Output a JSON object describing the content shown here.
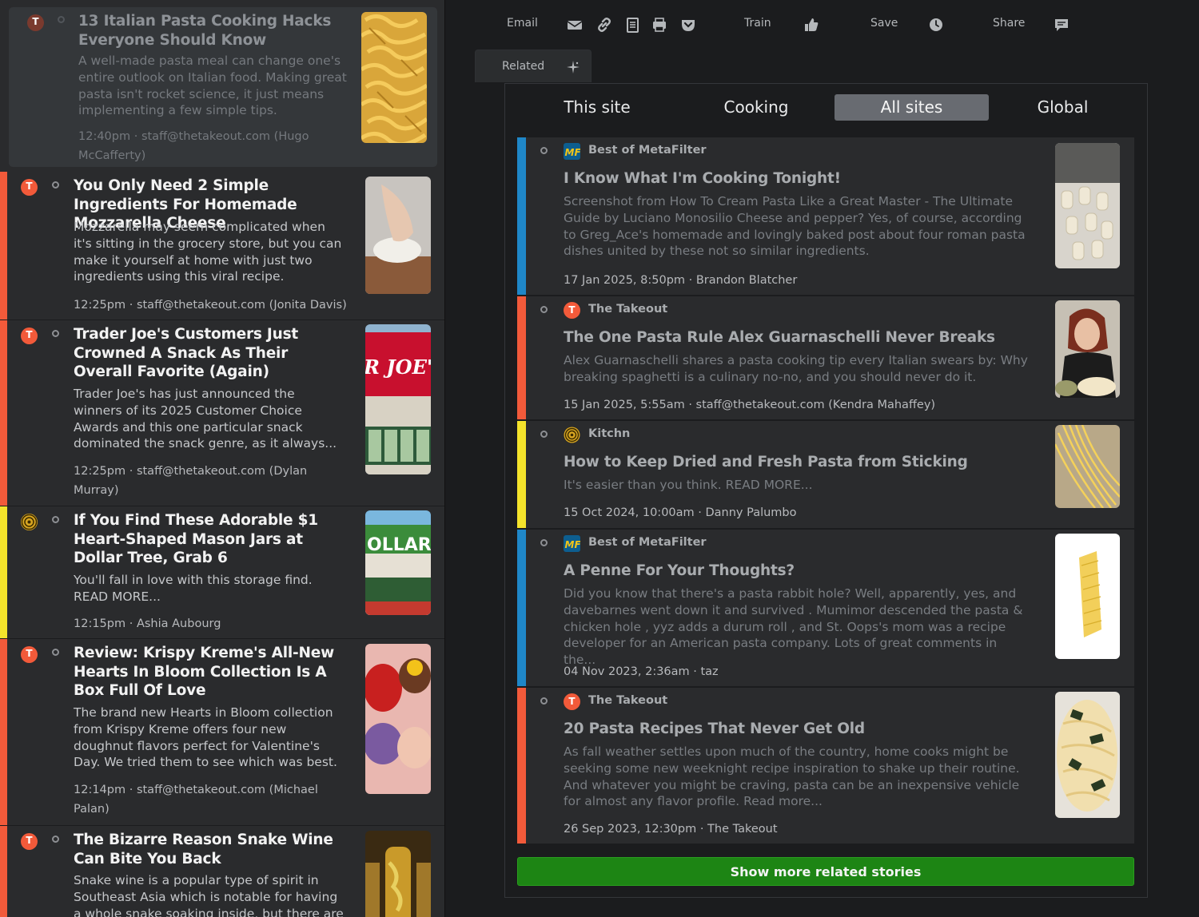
{
  "colors": {
    "takeout": "#f25a3a",
    "kitchn": "#f4e32b",
    "metafilter": "#1f87c8",
    "show_more": "#1d8514"
  },
  "toolbar": {
    "email": "Email",
    "train": "Train",
    "save": "Save",
    "share": "Share",
    "related": "Related",
    "icons": [
      "envelope-icon",
      "link-icon",
      "document-icon",
      "printer-icon",
      "pocket-icon",
      "thumbs-up-icon",
      "clock-icon",
      "comment-icon",
      "sparkle-icon"
    ]
  },
  "feed": {
    "stories": [
      {
        "title": "13 Italian Pasta Cooking Hacks Everyone Should Know",
        "snippet": "A well-made pasta meal can change one's entire outlook on Italian food. Making great pasta isn't rocket science, it just means implementing a few simple tips.",
        "meta": "12:40pm · staff@thetakeout.com (Hugo McCafferty)",
        "favicon": "T",
        "selected": true
      },
      {
        "title": "You Only Need 2 Simple Ingredients For Homemade Mozzarella Cheese",
        "snippet": "Mozzarella may seem complicated when it's sitting in the grocery store, but you can make it yourself at home with just two ingredients using this viral recipe.",
        "meta": "12:25pm · staff@thetakeout.com (Jonita Davis)",
        "favicon": "T"
      },
      {
        "title": "Trader Joe's Customers Just Crowned A Snack As Their Overall Favorite (Again)",
        "snippet": "Trader Joe's has just announced the winners of its 2025 Customer Choice Awards and this one particular snack dominated the snack genre, as it always...",
        "meta": "12:25pm · staff@thetakeout.com (Dylan Murray)",
        "favicon": "T",
        "thumb_text": "R JOE'"
      },
      {
        "title": "If You Find These Adorable $1 Heart-Shaped Mason Jars at Dollar Tree, Grab 6",
        "snippet": "You'll fall in love with this storage find. READ MORE...",
        "meta": "12:15pm · Ashia Aubourg",
        "favicon": "kitchn",
        "thumb_text": "OLLAR"
      },
      {
        "title": "Review: Krispy Kreme's All-New Hearts In Bloom Collection Is A Box Full Of Love",
        "snippet": "The brand new Hearts in Bloom collection from Krispy Kreme offers four new doughnut flavors perfect for Valentine's Day. We tried them to see which was best.",
        "meta": "12:14pm · staff@thetakeout.com (Michael Palan)",
        "favicon": "T"
      },
      {
        "title": "The Bizarre Reason Snake Wine Can Bite You Back",
        "snippet": "Snake wine is a popular type of spirit in Southeast Asia which is notable for having a whole snake soaking inside, but there are",
        "meta": "",
        "favicon": "T"
      }
    ]
  },
  "related": {
    "tabs": [
      "This site",
      "Cooking",
      "All sites",
      "Global"
    ],
    "active_tab": "All sites",
    "stories": [
      {
        "feed": "Best of MetaFilter",
        "feed_icon": "MF",
        "title": "I Know What I'm Cooking Tonight!",
        "snippet": "Screenshot from How To Cream Pasta Like a Great Master - The Ultimate Guide by Luciano Monosilio Cheese and pepper? Yes, of course, according to Greg_Ace's homemade and lovingly baked post about four roman pasta dishes united by these not so similar ingredients.",
        "meta": "17 Jan 2025, 8:50pm · Brandon Blatcher"
      },
      {
        "feed": "The Takeout",
        "feed_icon": "T",
        "title": "The One Pasta Rule Alex Guarnaschelli Never Breaks",
        "snippet": "Alex Guarnaschelli shares a pasta cooking tip every Italian swears by: Why breaking spaghetti is a culinary no-no, and you should never do it.",
        "meta": "15 Jan 2025, 5:55am · staff@thetakeout.com (Kendra Mahaffey)"
      },
      {
        "feed": "Kitchn",
        "feed_icon": "kitchn",
        "title": "How to Keep Dried and Fresh Pasta from Sticking",
        "snippet": "It's easier than you think. READ MORE...",
        "meta": "15 Oct 2024, 10:00am · Danny Palumbo"
      },
      {
        "feed": "Best of MetaFilter",
        "feed_icon": "MF",
        "title": "A Penne For Your Thoughts?",
        "snippet": "Did you know that there's a pasta rabbit hole? Well, apparently, yes, and davebarnes went down it and survived . Mumimor descended the pasta & chicken hole , yyz adds a durum roll , and St. Oops's mom was a recipe developer for an American pasta company. Lots of great comments in the...",
        "meta": "04 Nov 2023, 2:36am · taz"
      },
      {
        "feed": "The Takeout",
        "feed_icon": "T",
        "title": "20 Pasta Recipes That Never Get Old",
        "snippet": "As fall weather settles upon much of the country, home cooks might be seeking some new weeknight recipe inspiration to shake up their routine. And whatever you might be craving, pasta can be an inexpensive vehicle for almost any flavor profile. Read more...",
        "meta": "26 Sep 2023, 12:30pm · The Takeout"
      }
    ],
    "show_more": "Show more related stories"
  }
}
